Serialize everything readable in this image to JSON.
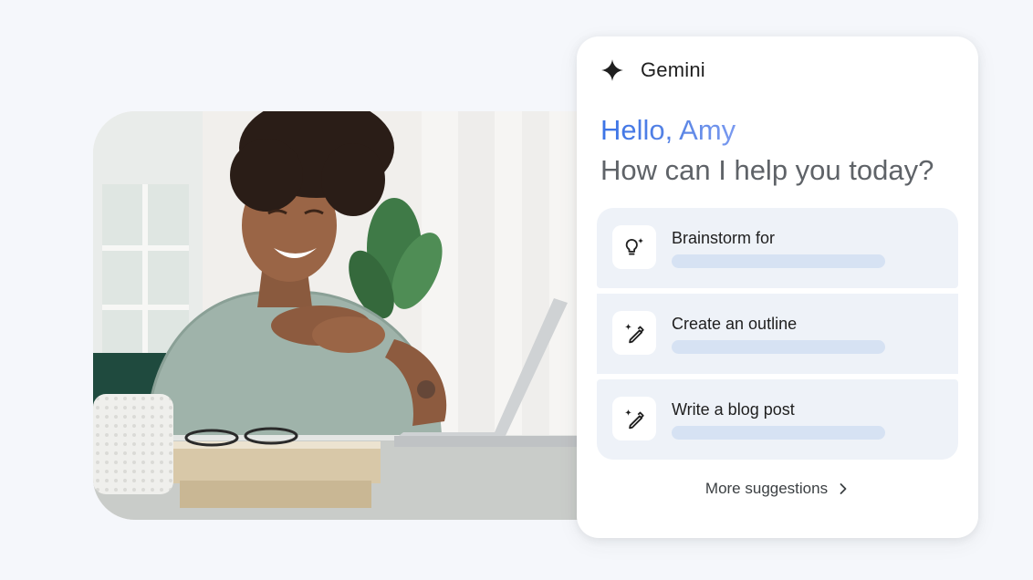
{
  "card": {
    "brand": "Gemini",
    "brand_icon": "sparkle-icon",
    "greeting": "Hello, Amy",
    "prompt": "How can I help you today?",
    "suggestions": [
      {
        "label": "Brainstorm for",
        "icon": "lightbulb-sparkle-icon"
      },
      {
        "label": "Create an outline",
        "icon": "magic-pen-icon"
      },
      {
        "label": "Write a blog post",
        "icon": "magic-pen-icon"
      }
    ],
    "more_label": "More suggestions",
    "more_icon": "chevron-right-icon"
  },
  "colors": {
    "page_bg": "#f5f7fb",
    "greeting_blue": "#3b73e6",
    "prompt_gray": "#5f6368",
    "suggestion_bg": "#eef2f8",
    "placeholder_bar": "#d6e2f3"
  }
}
